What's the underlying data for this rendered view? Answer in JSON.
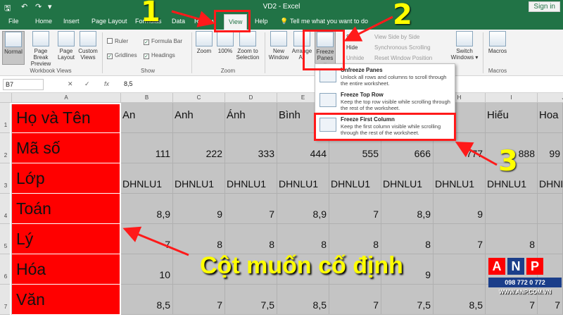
{
  "titlebar": {
    "title": "VD2  -  Excel",
    "signin": "Sign in"
  },
  "tabs": [
    "File",
    "Home",
    "Insert",
    "Page Layout",
    "Formulas",
    "Data",
    "Review",
    "View",
    "Help"
  ],
  "tell_me": "Tell me what you want to do",
  "ribbon": {
    "workbook_views": {
      "normal": "Normal",
      "page_break": "Page Break Preview",
      "page_layout": "Page Layout",
      "custom": "Custom Views",
      "group": "Workbook Views"
    },
    "show": {
      "ruler": "Ruler",
      "formula_bar": "Formula Bar",
      "gridlines": "Gridlines",
      "headings": "Headings",
      "group": "Show"
    },
    "zoom": {
      "zoom": "Zoom",
      "hundred": "100%",
      "zoom_sel": "Zoom to Selection",
      "group": "Zoom"
    },
    "window": {
      "new_window": "New Window",
      "arrange_all": "Arrange All",
      "freeze_panes": "Freeze Panes",
      "split": "Split",
      "hide": "Hide",
      "unhide": "Unhide",
      "side_by_side": "View Side by Side",
      "sync_scroll": "Synchronous Scrolling",
      "reset_pos": "Reset Window Position",
      "switch": "Switch Windows"
    },
    "macros": {
      "macros": "Macros",
      "group": "Macros"
    }
  },
  "formula_bar": {
    "name_box": "B7",
    "value": "8,5"
  },
  "columns": [
    "A",
    "B",
    "C",
    "D",
    "E",
    "F",
    "G",
    "H",
    "I",
    "J"
  ],
  "rows": [
    "1",
    "2",
    "3",
    "4",
    "5",
    "6",
    "7"
  ],
  "labels": [
    "Họ và Tên",
    "Mã số",
    "Lớp",
    "Toán",
    "Lý",
    "Hóa",
    "Văn"
  ],
  "data": [
    [
      "An",
      "Anh",
      "Ánh",
      "Bình",
      "",
      "",
      "",
      "Hiếu",
      "Hoa"
    ],
    [
      "111",
      "222",
      "333",
      "444",
      "555",
      "666",
      "777",
      "888",
      "99"
    ],
    [
      "DHNLU1",
      "DHNLU1",
      "DHNLU1",
      "DHNLU1",
      "DHNLU1",
      "DHNLU1",
      "DHNLU1",
      "DHNLU1",
      "DHNLU1"
    ],
    [
      "8,9",
      "9",
      "7",
      "8,9",
      "7",
      "8,9",
      "9",
      "",
      ""
    ],
    [
      "7",
      "8",
      "8",
      "8",
      "8",
      "8",
      "7",
      "8",
      ""
    ],
    [
      "10",
      "",
      "",
      "",
      "",
      "9",
      "",
      "",
      ""
    ],
    [
      "8,5",
      "7",
      "7,5",
      "8,5",
      "7",
      "7,5",
      "8,5",
      "7",
      "7"
    ]
  ],
  "dropdown": [
    {
      "title": "Unfreeze Panes",
      "desc": "Unlock all rows and columns to scroll through the entire worksheet."
    },
    {
      "title": "Freeze Top Row",
      "desc": "Keep the top row visible while scrolling through the rest of the worksheet."
    },
    {
      "title": "Freeze First Column",
      "desc": "Keep the first column visible while scrolling through the rest of the worksheet."
    }
  ],
  "steps": [
    "1",
    "2",
    "3"
  ],
  "caption": "Cột muốn cố định",
  "watermark": {
    "letters": [
      "A",
      "N",
      "P"
    ],
    "phone": "098 772 0 772",
    "url": "WWW.ANP.COM.VN"
  },
  "colors": {
    "excel_green": "#217346",
    "label_red": "#ff0000",
    "annotation_red": "#ff1a1a",
    "annotation_yellow": "#ffff00"
  }
}
